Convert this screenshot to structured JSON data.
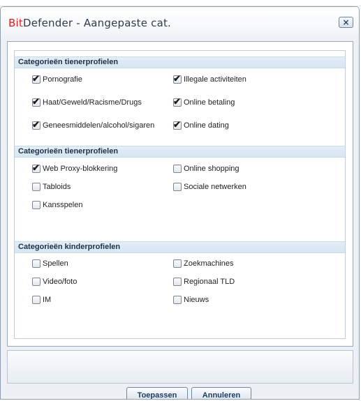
{
  "window": {
    "title_brand": "Bit",
    "title_rest": "Defender - Aangepaste cat.",
    "close_glyph": "×"
  },
  "sections": [
    {
      "header": "Categorieën tienerprofielen",
      "items": [
        {
          "label": "Pornografie",
          "checked": true
        },
        {
          "label": "Illegale activiteiten",
          "checked": true
        },
        {
          "label": "Haat/Geweld/Racisme/Drugs",
          "checked": true
        },
        {
          "label": "Online betaling",
          "checked": true
        },
        {
          "label": "Geneesmiddelen/alcohol/sigaren",
          "checked": true
        },
        {
          "label": "Online dating",
          "checked": true
        }
      ]
    },
    {
      "header": "Categorieën tienerprofielen",
      "items": [
        {
          "label": "Web Proxy-blokkering",
          "checked": true
        },
        {
          "label": "Online shopping",
          "checked": false
        },
        {
          "label": "Tabloids",
          "checked": false
        },
        {
          "label": "Sociale netwerken",
          "checked": false
        },
        {
          "label": "Kansspelen",
          "checked": false
        }
      ]
    },
    {
      "header": "Categorieën kinderprofielen",
      "items": [
        {
          "label": "Spellen",
          "checked": false
        },
        {
          "label": "Zoekmachines",
          "checked": false
        },
        {
          "label": "Video/foto",
          "checked": false
        },
        {
          "label": "Regionaal TLD",
          "checked": false
        },
        {
          "label": "IM",
          "checked": false
        },
        {
          "label": "Nieuws",
          "checked": false
        }
      ]
    }
  ],
  "buttons": {
    "apply": "Toepassen",
    "cancel": "Annuleren"
  },
  "icons": {
    "checkmark": "✔"
  },
  "colors": {
    "brand_red": "#e41d1d",
    "section_header_bg": "#d6e6f3"
  }
}
